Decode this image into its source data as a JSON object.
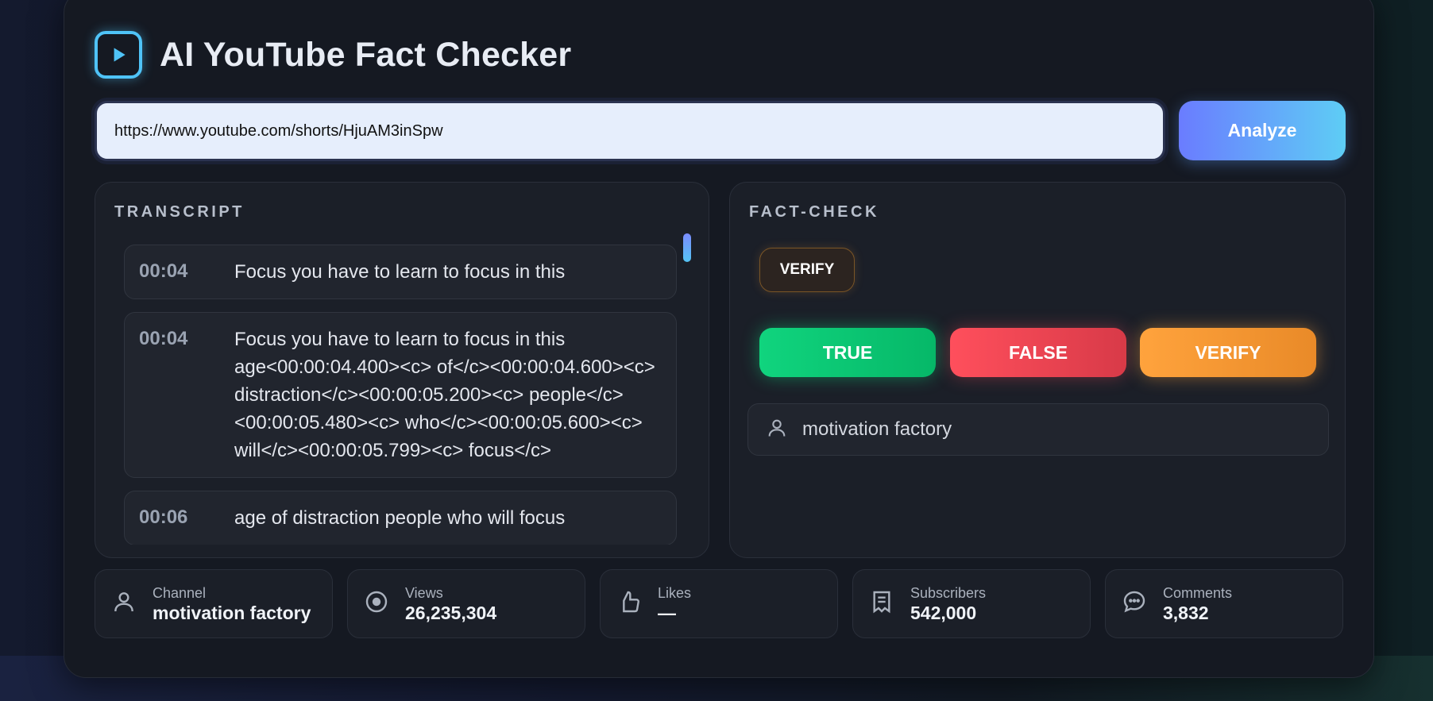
{
  "app": {
    "title": "AI YouTube Fact Checker",
    "icons": {
      "logo": "play-icon"
    }
  },
  "search": {
    "url_value": "https://www.youtube.com/shorts/HjuAM3inSpw",
    "analyze_label": "Analyze"
  },
  "transcript": {
    "heading": "TRANSCRIPT",
    "segments": [
      {
        "time": "00:04",
        "text": "Focus you have to learn to focus in this"
      },
      {
        "time": "00:04",
        "text": "Focus you have to learn to focus in this age<00:00:04.400><c> of</c><00:00:04.600><c> distraction</c><00:00:05.200><c> people</c><00:00:05.480><c> who</c><00:00:05.600><c> will</c><00:00:05.799><c> focus</c>"
      },
      {
        "time": "00:06",
        "text": "age of distraction people who will focus"
      }
    ]
  },
  "factcheck": {
    "heading": "FACT-CHECK",
    "badge": "VERIFY",
    "verdicts": {
      "true_label": "TRUE",
      "false_label": "FALSE",
      "verify_label": "VERIFY"
    },
    "source": "motivation factory"
  },
  "stats": {
    "channel": {
      "label": "Channel",
      "value": "motivation factory",
      "icon": "user-icon"
    },
    "views": {
      "label": "Views",
      "value": "26,235,304",
      "icon": "eye-icon"
    },
    "likes": {
      "label": "Likes",
      "value": "—",
      "icon": "thumbs-up-icon"
    },
    "subscribers": {
      "label": "Subscribers",
      "value": "542,000",
      "icon": "document-icon"
    },
    "comments": {
      "label": "Comments",
      "value": "3,832",
      "icon": "comment-icon"
    }
  },
  "colors": {
    "accent_blue": "#4fc3f7",
    "analyze_gradient_start": "#6a7cff",
    "analyze_gradient_end": "#5ecdf5",
    "true_green": "#10d47e",
    "false_red": "#ff4f5c",
    "verify_orange": "#ffa33d"
  }
}
